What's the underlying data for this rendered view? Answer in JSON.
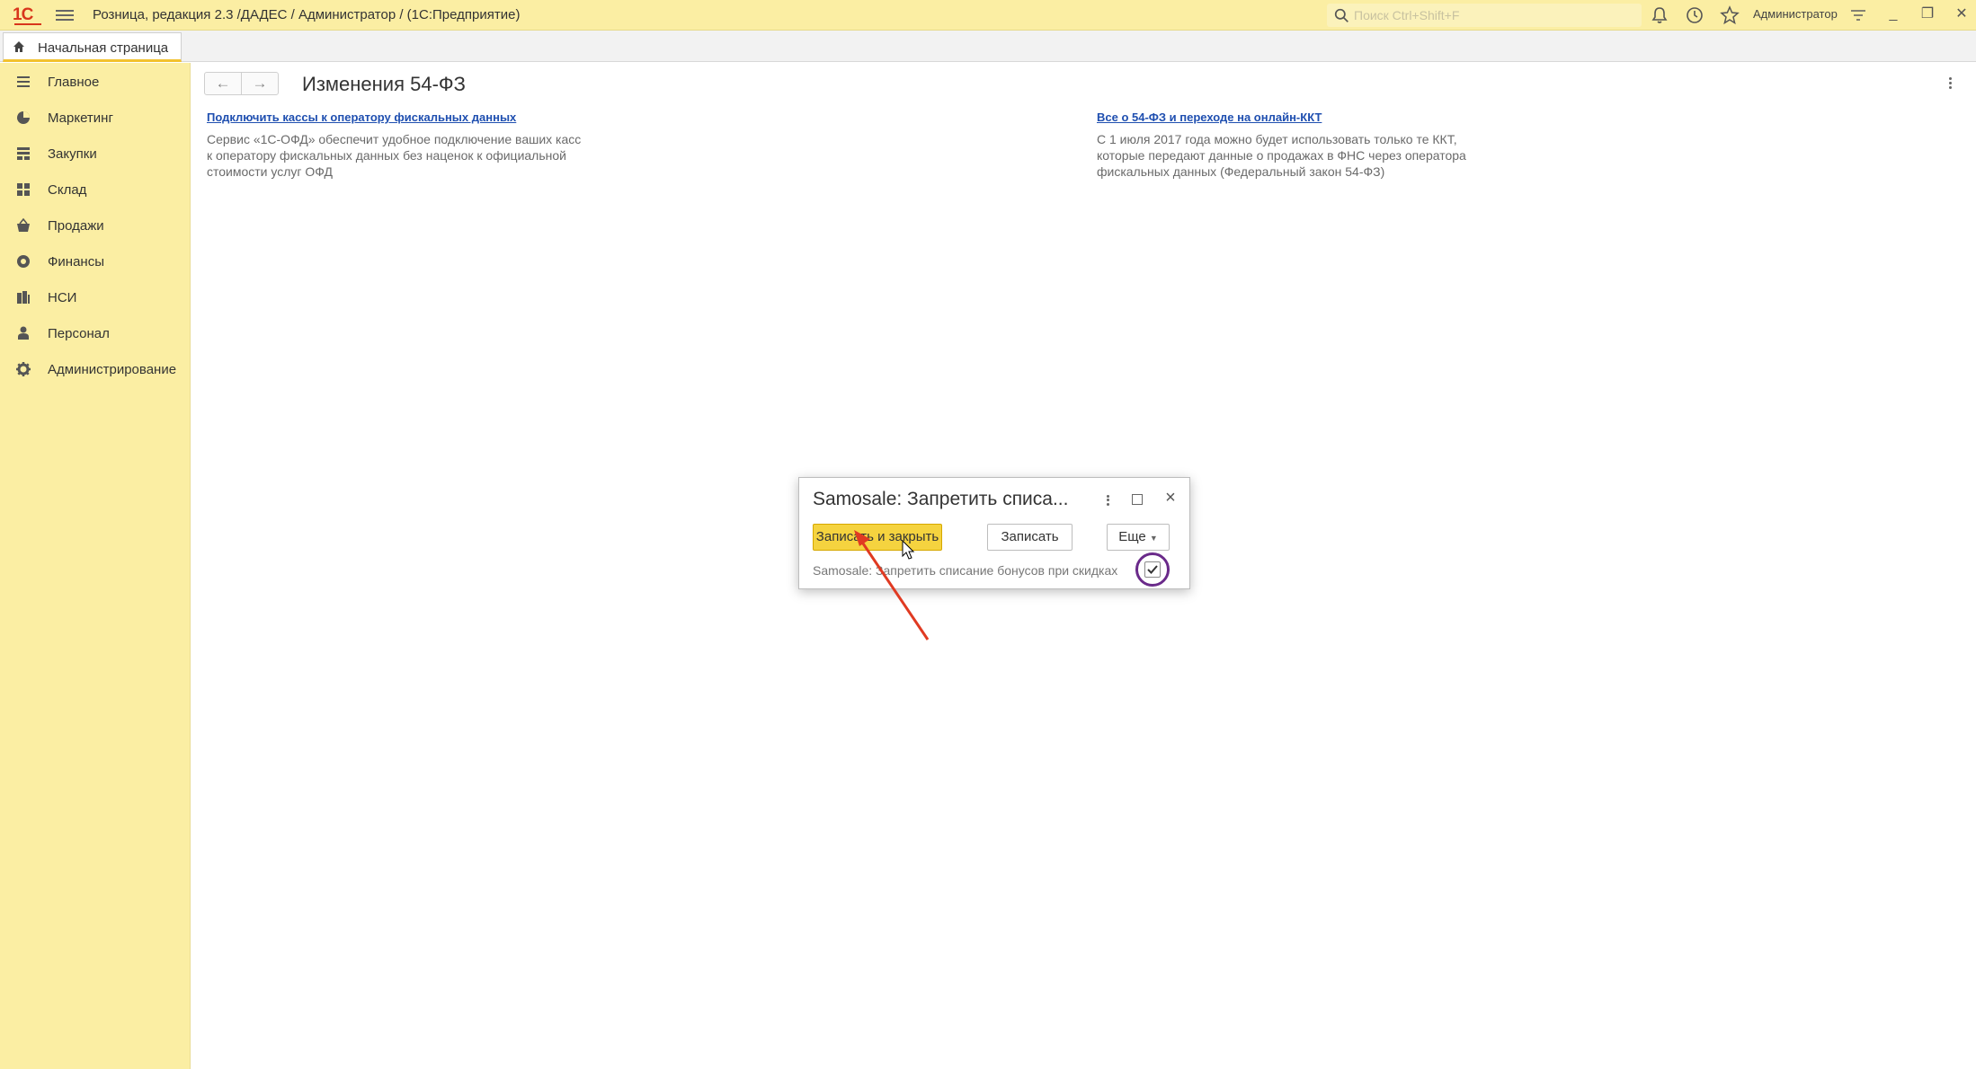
{
  "titlebar": {
    "logo": "1С",
    "title": "Розница, редакция 2.3 /ДАДЕС / Администратор /  (1С:Предприятие)",
    "search_placeholder": "Поиск Ctrl+Shift+F",
    "user": "Администратор",
    "icons": [
      "menu-icon",
      "search-icon",
      "bell-icon",
      "history-icon",
      "star-icon",
      "filter-icon",
      "minimize-icon",
      "restore-icon",
      "close-icon"
    ]
  },
  "tabs": {
    "home": "Начальная страница"
  },
  "sidebar": {
    "items": [
      {
        "label": "Главное",
        "icon": "list-icon"
      },
      {
        "label": "Маркетинг",
        "icon": "pie-chart-icon"
      },
      {
        "label": "Закупки",
        "icon": "cart-icon"
      },
      {
        "label": "Склад",
        "icon": "grid-icon"
      },
      {
        "label": "Продажи",
        "icon": "basket-icon"
      },
      {
        "label": "Финансы",
        "icon": "coin-icon"
      },
      {
        "label": "НСИ",
        "icon": "books-icon"
      },
      {
        "label": "Персонал",
        "icon": "person-icon"
      },
      {
        "label": "Администрирование",
        "icon": "gear-icon"
      }
    ]
  },
  "content": {
    "nav_back": "←",
    "nav_forward": "→",
    "title": "Изменения 54-ФЗ",
    "news": [
      {
        "link": "Подключить кассы к оператору фискальных данных",
        "lines": [
          "Сервис «1С-ОФД» обеспечит удобное подключение ваших касс",
          "к оператору фискальных данных без наценок к официальной",
          "стоимости услуг ОФД"
        ]
      },
      {
        "link": "Все о 54-ФЗ и переходе на онлайн-ККТ",
        "lines": [
          "С 1 июля 2017 года можно будет использовать только те ККТ,",
          "которые передают данные о продажах в ФНС через оператора",
          "фискальных данных (Федеральный закон 54-ФЗ)"
        ]
      }
    ]
  },
  "dialog": {
    "title": "Samosale: Запретить списа...",
    "save_close": "Записать и закрыть",
    "save": "Записать",
    "more": "Еще",
    "checkbox_label": "Samosale: Запретить списание бонусов при скидках",
    "checkbox_checked": true
  },
  "colors": {
    "accent_yellow": "#fbeea3",
    "primary_button": "#f5d33f",
    "link": "#1f4fb0",
    "annotation_arrow": "#e03a22",
    "highlight_circle": "#6a2a8a"
  }
}
